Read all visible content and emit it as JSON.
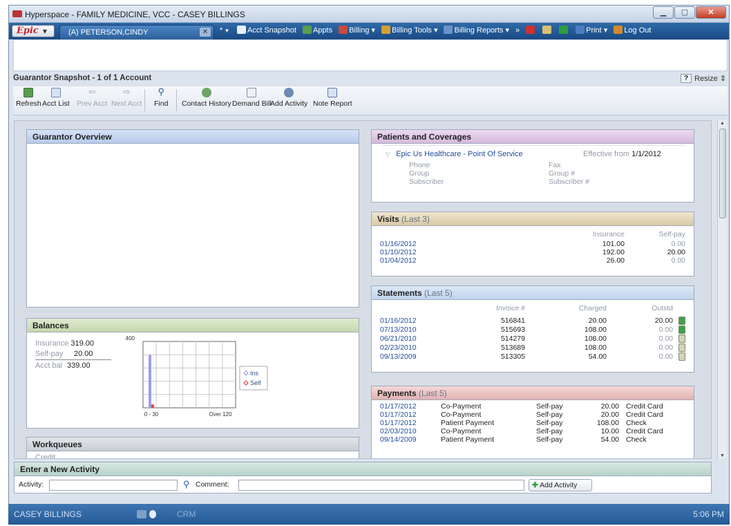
{
  "window": {
    "title": "Hyperspace - FAMILY MEDICINE, VCC - CASEY BILLINGS"
  },
  "epicbar": {
    "epic_label": "Epic",
    "patient_tab": "(A) PETERSON,CINDY",
    "new_tab": "*",
    "items": [
      {
        "label": "Acct Snapshot",
        "icon": "snapshot-icon",
        "color": "#e7f0fb"
      },
      {
        "label": "Appts",
        "icon": "people-icon",
        "color": "#5aa050"
      },
      {
        "label": "Billing",
        "icon": "billing-icon",
        "color": "#c84b3a",
        "dd": true
      },
      {
        "label": "Billing Tools",
        "icon": "tools-icon",
        "color": "#d4a030",
        "dd": true
      },
      {
        "label": "Billing Reports",
        "icon": "reports-icon",
        "color": "#6b93c9",
        "dd": true
      },
      {
        "label": "»",
        "icon": "more-icon",
        "color": "transparent"
      },
      {
        "label": "",
        "icon": "clock-icon",
        "color": "#d03030"
      },
      {
        "label": "",
        "icon": "signature-icon",
        "color": "#d8c070"
      },
      {
        "label": "",
        "icon": "globe-icon",
        "color": "#2e9e3e"
      },
      {
        "label": "Print",
        "icon": "printer-icon",
        "color": "#4b7ec0",
        "dd": true
      },
      {
        "label": "Log Out",
        "icon": "logout-icon",
        "color": "#d48a2a"
      }
    ]
  },
  "activity": {
    "title": "Guarantor Snapshot - 1 of 1 Account",
    "help": "?",
    "resize": "Resize"
  },
  "toolbar": {
    "refresh": "Refresh",
    "acct_list": "Acct List",
    "prev_acct": "Prev Acct",
    "next_acct": "Next Acct",
    "find": "Find",
    "contact_history": "Contact History",
    "demand_bill": "Demand Bill",
    "add_activity": "Add Activity",
    "note_report": "Note Report"
  },
  "guarantor_overview": {
    "title": "Guarantor Overview"
  },
  "balances": {
    "title": "Balances",
    "insurance_label": "Insurance",
    "insurance_value": "319.00",
    "selfpay_label": "Self-pay",
    "selfpay_value": "20.00",
    "acctbal_label": "Acct bal",
    "acctbal_value": "339.00"
  },
  "chart_data": {
    "type": "bar",
    "categories": [
      "0 - 30",
      "Over 120"
    ],
    "series": [
      {
        "name": "Ins",
        "values": [
          319,
          0
        ],
        "color": "#9c9ee8"
      },
      {
        "name": "Self",
        "values": [
          20,
          0
        ],
        "color": "#e0454d"
      }
    ],
    "ylim": [
      0,
      400
    ],
    "ytick": "400",
    "legend": "right"
  },
  "workqueues": {
    "title": "Workqueues",
    "first_item": "Credit"
  },
  "patients": {
    "title": "Patients and Coverages",
    "plan": "Epic Us Healthcare - Point Of Service",
    "effective_label": "Effective from",
    "effective_value": "1/1/2012",
    "fields": {
      "phone": "Phone",
      "group": "Group",
      "subscriber": "Subscriber",
      "fax": "Fax",
      "group_no": "Group #",
      "subscriber_no": "Subscriber #"
    }
  },
  "visits": {
    "title": "Visits",
    "sub": "(Last 3)",
    "col_ins": "Insurance",
    "col_self": "Self-pay",
    "rows": [
      {
        "date": "01/16/2012",
        "ins": "101.00",
        "self": "0.00"
      },
      {
        "date": "01/10/2012",
        "ins": "192.00",
        "self": "20.00"
      },
      {
        "date": "01/04/2012",
        "ins": "26.00",
        "self": "0.00"
      }
    ]
  },
  "statements": {
    "title": "Statements",
    "sub": "(Last 5)",
    "col_invoice": "Invoice #",
    "col_charged": "Charged",
    "col_outstd": "Outstd",
    "rows": [
      {
        "date": "01/16/2012",
        "invoice": "516841",
        "charged": "20.00",
        "outstd": "20.00"
      },
      {
        "date": "07/13/2010",
        "invoice": "515693",
        "charged": "108.00",
        "outstd": "0.00"
      },
      {
        "date": "06/21/2010",
        "invoice": "514279",
        "charged": "108.00",
        "outstd": "0.00"
      },
      {
        "date": "02/23/2010",
        "invoice": "513689",
        "charged": "108.00",
        "outstd": "0.00"
      },
      {
        "date": "09/13/2009",
        "invoice": "513305",
        "charged": "54.00",
        "outstd": "0.00"
      }
    ]
  },
  "payments": {
    "title": "Payments",
    "sub": "(Last 5)",
    "rows": [
      {
        "date": "01/17/2012",
        "type": "Co-Payment",
        "source": "Self-pay",
        "amount": "20.00",
        "method": "Credit Card"
      },
      {
        "date": "01/17/2012",
        "type": "Co-Payment",
        "source": "Self-pay",
        "amount": "20.00",
        "method": "Credit Card"
      },
      {
        "date": "01/17/2012",
        "type": "Patient Payment",
        "source": "Self-pay",
        "amount": "108.00",
        "method": "Check"
      },
      {
        "date": "02/03/2010",
        "type": "Co-Payment",
        "source": "Self-pay",
        "amount": "10.00",
        "method": "Credit Card"
      },
      {
        "date": "09/14/2009",
        "type": "Patient Payment",
        "source": "Self-pay",
        "amount": "54.00",
        "method": "Check"
      }
    ]
  },
  "new_activity": {
    "title": "Enter a New Activity",
    "activity_label": "Activity:",
    "comment_label": "Comment:",
    "add_button": "Add Activity"
  },
  "status": {
    "user": "CASEY BILLINGS",
    "crm": "CRM",
    "time": "5:06 PM"
  }
}
